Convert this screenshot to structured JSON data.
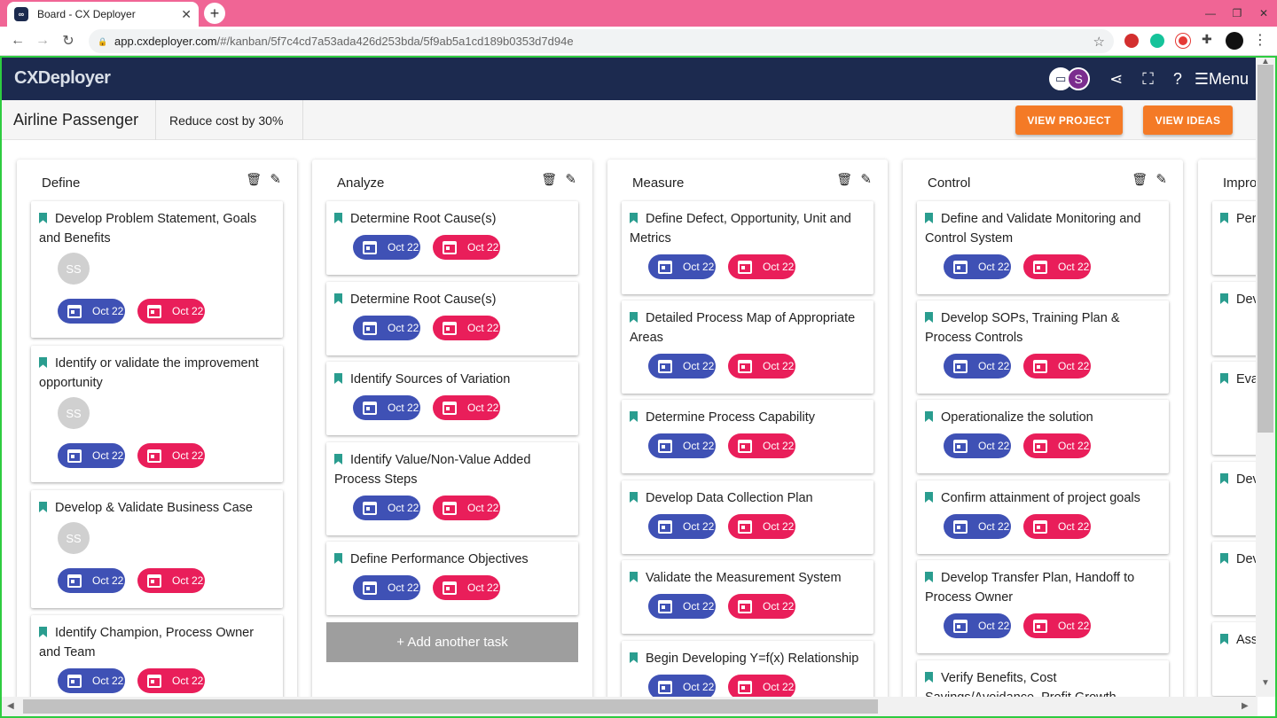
{
  "browser": {
    "tab_title": "Board - CX Deployer",
    "tab_favicon": "∞",
    "url_host": "app.cxdeployer.com",
    "url_path": "/#/kanban/5f7c4cd7a53ada426d253bda/5f9ab5a1cd189b0353d7d94e"
  },
  "app": {
    "logo": "CXDeployer",
    "user_initial": "S",
    "menu_label": "☰Menu"
  },
  "project": {
    "name": "Airline Passenger",
    "goal": "Reduce cost by 30%",
    "view_project": "VIEW PROJECT",
    "view_ideas": "VIEW IDEAS"
  },
  "columns": [
    {
      "title": "Define",
      "cards": [
        {
          "title": "Develop Problem Statement, Goals and Benefits",
          "avatar": "SS",
          "start": "Oct 22",
          "due": "Oct 22"
        },
        {
          "title": "Identify or validate the improvement opportunity",
          "avatar": "SS",
          "start": "Oct 22",
          "due": "Oct 22"
        },
        {
          "title": "Develop & Validate Business Case",
          "avatar": "SS",
          "start": "Oct 22",
          "due": "Oct 22"
        },
        {
          "title": "Identify Champion, Process Owner and Team",
          "start": "Oct 22",
          "due": "Oct 22"
        }
      ]
    },
    {
      "title": "Analyze",
      "add_task": "+ Add another task",
      "cards": [
        {
          "title": "Determine Root Cause(s)",
          "start": "Oct 22",
          "due": "Oct 22"
        },
        {
          "title": "Determine Root Cause(s)",
          "start": "Oct 22",
          "due": "Oct 22"
        },
        {
          "title": "Identify Sources of Variation",
          "start": "Oct 22",
          "due": "Oct 22"
        },
        {
          "title": "Identify Value/Non-Value Added Process Steps",
          "start": "Oct 22",
          "due": "Oct 22"
        },
        {
          "title": "Define Performance Objectives",
          "start": "Oct 22",
          "due": "Oct 22"
        }
      ]
    },
    {
      "title": "Measure",
      "cards": [
        {
          "title": "Define Defect, Opportunity, Unit and Metrics",
          "start": "Oct 22",
          "due": "Oct 22"
        },
        {
          "title": "Detailed Process Map of Appropriate Areas",
          "start": "Oct 22",
          "due": "Oct 22"
        },
        {
          "title": "Determine Process Capability",
          "start": "Oct 22",
          "due": "Oct 22"
        },
        {
          "title": "Develop Data Collection Plan",
          "start": "Oct 22",
          "due": "Oct 22"
        },
        {
          "title": "Validate the Measurement System",
          "start": "Oct 22",
          "due": "Oct 22"
        },
        {
          "title": "Begin Developing Y=f(x) Relationship",
          "start": "Oct 22",
          "due": "Oct 22"
        }
      ]
    },
    {
      "title": "Control",
      "cards": [
        {
          "title": "Define and Validate Monitoring and Control System",
          "start": "Oct 22",
          "due": "Oct 22"
        },
        {
          "title": "Develop SOPs, Training Plan & Process Controls",
          "start": "Oct 22",
          "due": "Oct 22"
        },
        {
          "title": "Operationalize the solution",
          "start": "Oct 22",
          "due": "Oct 22"
        },
        {
          "title": "Confirm attainment of project goals",
          "start": "Oct 22",
          "due": "Oct 22"
        },
        {
          "title": "Develop Transfer Plan, Handoff to Process Owner",
          "start": "Oct 22",
          "due": "Oct 22"
        },
        {
          "title": "Verify Benefits, Cost Savings/Avoidance, Profit Growth"
        }
      ]
    },
    {
      "title": "Improve",
      "cards": [
        {
          "title": "Perform"
        },
        {
          "title": "Develop"
        },
        {
          "title": "Evaluate Solutions"
        },
        {
          "title": "Develop"
        },
        {
          "title": "Develop"
        },
        {
          "title": "Assess Solutions"
        }
      ]
    }
  ],
  "colors": {
    "nav_bg": "#1c2a4f",
    "accent_orange": "#f47a26",
    "start_chip": "#3f51b5",
    "due_chip": "#e91e5a",
    "bookmark": "#2a9d8f",
    "browser_tab_strip": "#f06595"
  }
}
